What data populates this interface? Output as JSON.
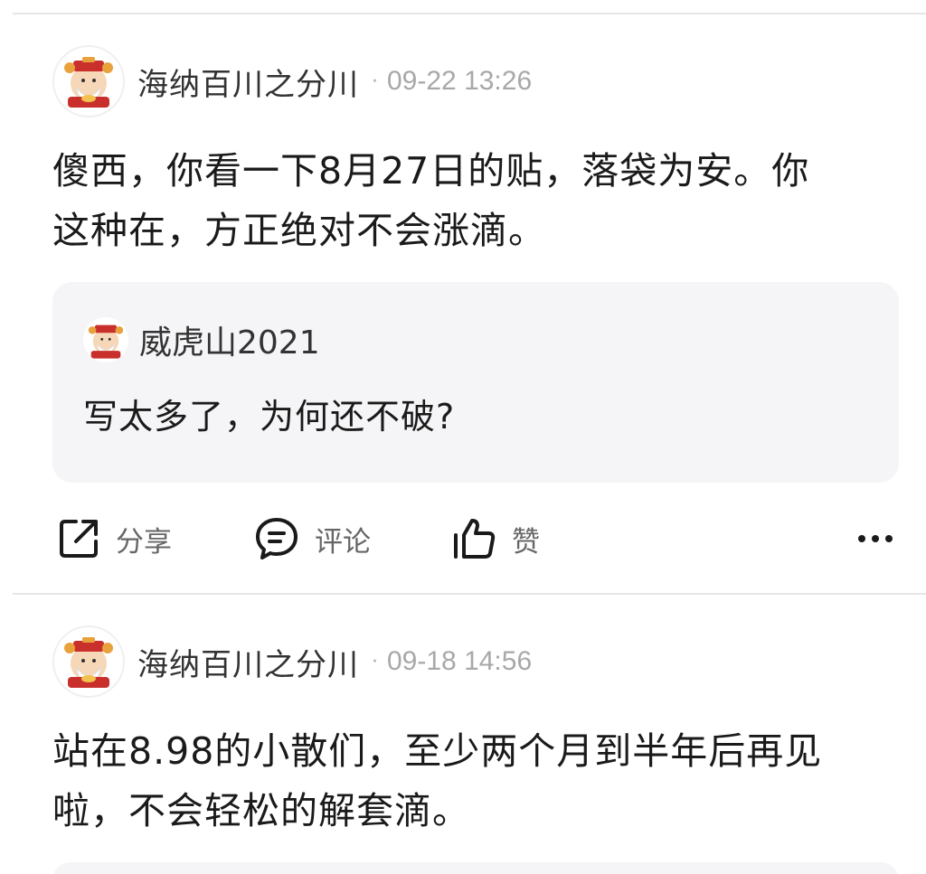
{
  "posts": [
    {
      "author": "海纳百川之分川",
      "separator": "·",
      "time": "09-22 13:26",
      "body_line1": "傻西，你看一下8月27日的贴，落袋为安。你",
      "body_line2": "这种在，方正绝对不会涨滴。",
      "quote": {
        "author": "威虎山2021",
        "text": "写太多了，为何还不破?"
      },
      "actions": {
        "share_label": "分享",
        "comment_label": "评论",
        "like_label": "赞"
      }
    },
    {
      "author": "海纳百川之分川",
      "separator": "·",
      "time": "09-18 14:56",
      "body_line1": "站在8.98的小散们，至少两个月到半年后再见",
      "body_line2": "啦，不会轻松的解套滴。"
    }
  ],
  "icons": {
    "avatar": "caishen-avatar-icon",
    "share": "share-icon",
    "comment": "comment-icon",
    "like": "thumbs-up-icon",
    "more": "more-dots-icon"
  },
  "colors": {
    "text": "#1a1a1a",
    "muted": "#a8a8a8",
    "quote_bg": "#f5f5f7"
  }
}
